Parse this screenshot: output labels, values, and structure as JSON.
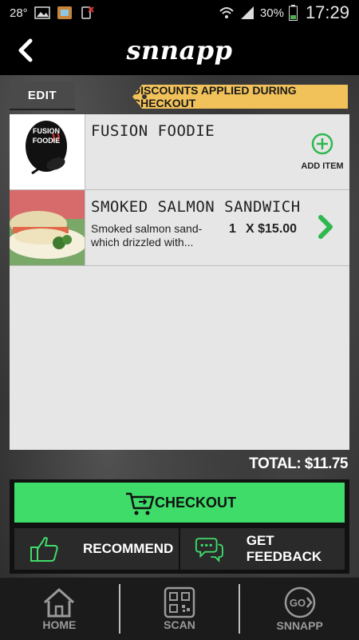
{
  "status_bar": {
    "temperature": "28°",
    "battery": "30%",
    "time": "17:29"
  },
  "app": {
    "logo": "snnapp",
    "back_icon": "chevron-left-icon"
  },
  "toolbar": {
    "edit_label": "EDIT",
    "discount_notice": "DISCOUNTS APPLIED DURING CHECKOUT"
  },
  "cart": {
    "restaurant": {
      "name": "FUSION FOODIE",
      "logo_text_line1": "FUSION",
      "logo_text_line2": "FOODIE",
      "add_item_label": "ADD ITEM"
    },
    "items": [
      {
        "name": "SMOKED SALMON SANDWICH",
        "description": "Smoked salmon sand-which drizzled with...",
        "quantity": "1",
        "price": "X $15.00"
      }
    ],
    "total_label": "TOTAL: $11.75"
  },
  "actions": {
    "checkout_label": "CHECKOUT",
    "recommend_label": "RECOMMEND",
    "feedback_label": "GET FEEDBACK"
  },
  "bottom_nav": {
    "items": [
      {
        "label": "HOME",
        "icon": "home-icon"
      },
      {
        "label": "SCAN",
        "icon": "qr-code-icon"
      },
      {
        "label": "SNNAPP",
        "icon": "go-icon"
      }
    ]
  },
  "colors": {
    "accent_green": "#3fdc6a",
    "discount_yellow": "#f2c25a"
  }
}
